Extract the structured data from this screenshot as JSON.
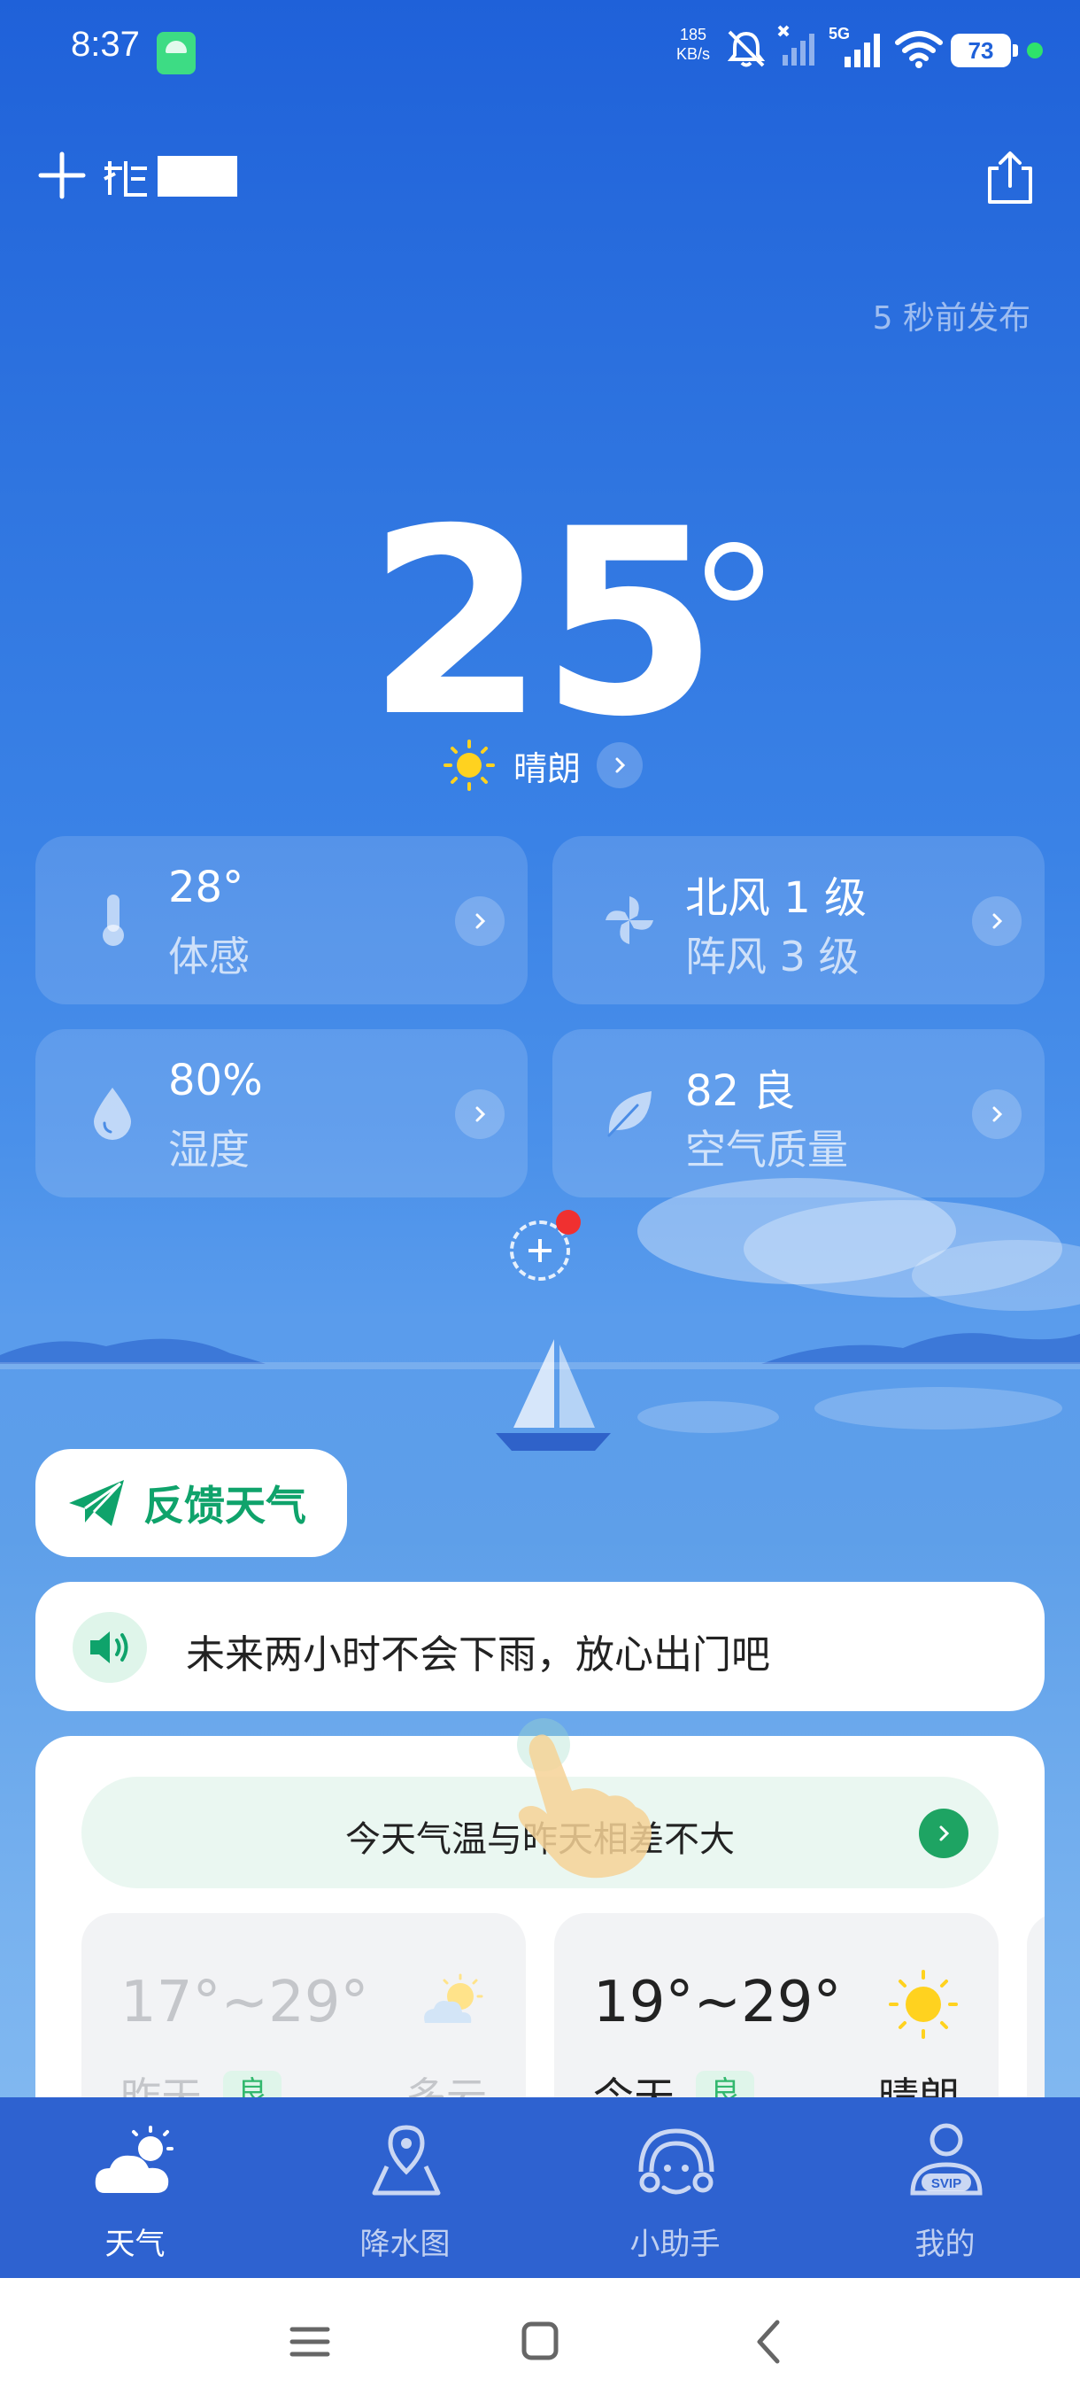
{
  "status_bar": {
    "time": "8:37",
    "net_speed_value": "185",
    "net_speed_unit": "KB/s",
    "network": "5G",
    "battery": "73",
    "icons": [
      "android-app-icon",
      "mute-icon",
      "signal-off-icon",
      "signal-5g-icon",
      "wifi-icon",
      "battery-icon"
    ]
  },
  "header": {
    "add_icon": "plus-icon",
    "share_icon": "share-icon",
    "published": "5 秒前发布"
  },
  "current": {
    "temperature": "25",
    "condition": "晴朗",
    "condition_icon": "sun-icon"
  },
  "cards": [
    {
      "icon": "thermometer-icon",
      "value": "28°",
      "label": "体感"
    },
    {
      "icon": "wind-icon",
      "value": "北风 1 级",
      "label": "阵风 3 级"
    },
    {
      "icon": "droplet-icon",
      "value": "80%",
      "label": "湿度"
    },
    {
      "icon": "leaf-icon",
      "value": "82 良",
      "label": "空气质量"
    }
  ],
  "feedback": {
    "label": "反馈天气",
    "icon": "paper-plane-icon"
  },
  "alert": {
    "text": "未来两小时不会下雨，放心出门吧",
    "icon": "speaker-icon"
  },
  "compare": {
    "text": "今天气温与昨天相差不大"
  },
  "days": [
    {
      "range": "17°~29°",
      "label": "昨天",
      "aqi": "良",
      "condition": "多云",
      "icon": "partly-cloudy-icon"
    },
    {
      "range": "19°~29°",
      "label": "今天",
      "aqi": "良",
      "condition": "晴朗",
      "icon": "sun-icon"
    }
  ],
  "tabs": [
    {
      "label": "天气",
      "icon": "weather-icon",
      "active": true
    },
    {
      "label": "降水图",
      "icon": "map-pin-icon",
      "active": false
    },
    {
      "label": "小助手",
      "icon": "assistant-icon",
      "active": false
    },
    {
      "label": "我的",
      "icon": "profile-svip-icon",
      "active": false
    }
  ],
  "colors": {
    "bg_top": "#1f61d9",
    "bg_bottom": "#8ec1f2",
    "accent_green": "#0fa36b",
    "tabbar": "#2e62d0"
  }
}
